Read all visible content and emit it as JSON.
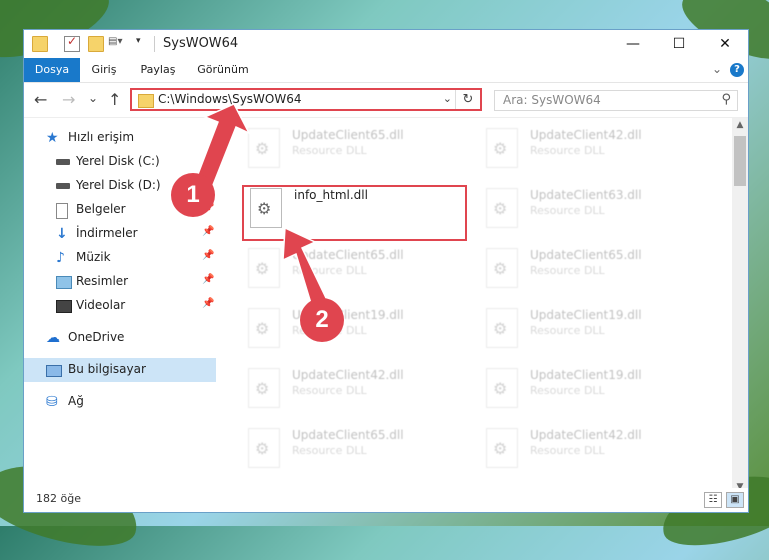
{
  "titlebar": {
    "title": "SysWOW64",
    "minimize": "—",
    "maximize": "☐",
    "close": "✕"
  },
  "ribbon": {
    "tabs": [
      "Dosya",
      "Giriş",
      "Paylaş",
      "Görünüm"
    ],
    "help": "?"
  },
  "navbar": {
    "back": "←",
    "forward": "→",
    "recent": "⌄",
    "up": "↑",
    "address": "C:\\Windows\\SysWOW64",
    "search_placeholder": "Ara: SysWOW64"
  },
  "sidebar": {
    "items": [
      {
        "label": "Hızlı erişim",
        "icon": "star-icon"
      },
      {
        "label": "Yerel Disk (C:)",
        "icon": "drive-icon"
      },
      {
        "label": "Yerel Disk (D:)",
        "icon": "drive-icon"
      },
      {
        "label": "Belgeler",
        "icon": "documents-icon"
      },
      {
        "label": "İndirmeler",
        "icon": "downloads-icon"
      },
      {
        "label": "Müzik",
        "icon": "music-icon"
      },
      {
        "label": "Resimler",
        "icon": "pictures-icon"
      },
      {
        "label": "Videolar",
        "icon": "videos-icon"
      },
      {
        "label": "OneDrive",
        "icon": "onedrive-icon"
      },
      {
        "label": "Bu bilgisayar",
        "icon": "computer-icon"
      },
      {
        "label": "Ağ",
        "icon": "network-icon"
      }
    ]
  },
  "files": {
    "highlighted": {
      "name": "info_html.dll",
      "type": ""
    },
    "left": [
      {
        "name": "UpdateClient65.dll",
        "type": "Resource DLL"
      },
      {
        "name": "UpdateClient65.dll",
        "type": "Resource DLL"
      },
      {
        "name": "UpdateClient19.dll",
        "type": "Resource DLL"
      },
      {
        "name": "UpdateClient42.dll",
        "type": "Resource DLL"
      },
      {
        "name": "UpdateClient65.dll",
        "type": "Resource DLL"
      }
    ],
    "right": [
      {
        "name": "UpdateClient42.dll",
        "type": "Resource DLL"
      },
      {
        "name": "UpdateClient63.dll",
        "type": "Resource DLL"
      },
      {
        "name": "UpdateClient65.dll",
        "type": "Resource DLL"
      },
      {
        "name": "UpdateClient19.dll",
        "type": "Resource DLL"
      },
      {
        "name": "UpdateClient19.dll",
        "type": "Resource DLL"
      },
      {
        "name": "UpdateClient42.dll",
        "type": "Resource DLL"
      }
    ]
  },
  "status": {
    "count": "182 öğe"
  },
  "callouts": [
    "1",
    "2"
  ],
  "colors": {
    "accent": "#1979ca",
    "highlight": "#e0454f"
  }
}
